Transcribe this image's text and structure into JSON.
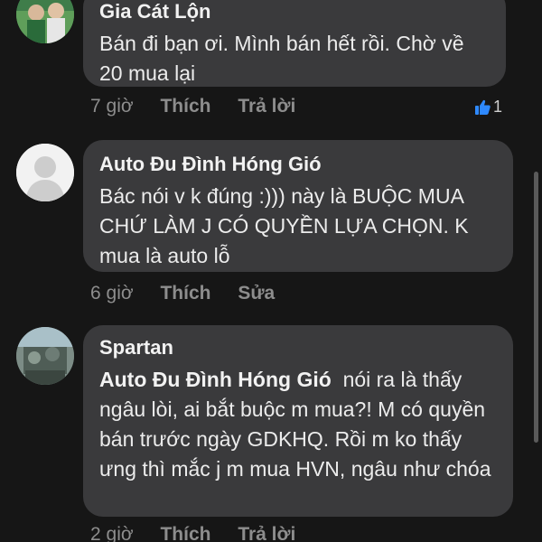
{
  "comments": [
    {
      "author": "Gia Cát Lộn",
      "text": "Bán đi bạn ơi. Mình bán hết rồi. Chờ về 20 mua lại",
      "time": "7 giờ",
      "like_label": "Thích",
      "second_action": "Trả lời",
      "reaction_count": "1",
      "reaction_icon": "thumbs-up-icon",
      "reaction_color": "#2e89ff"
    },
    {
      "author": "Auto Đu Đình Hóng Gió",
      "text": "Bác nói v k đúng :))) này là BUỘC MUA CHỨ LÀM J CÓ QUYỀN LỰA CHỌN. K mua là auto lỗ",
      "time": "6 giờ",
      "like_label": "Thích",
      "second_action": "Sửa"
    },
    {
      "author": "Spartan",
      "mention": "Auto Đu Đình Hóng Gió",
      "text": "nói ra là thấy ngâu lòi, ai bắt buộc m mua?! M có quyền bán trước ngày GDKHQ. Rồi m ko thấy ưng thì mắc j m mua HVN, ngâu như chóa",
      "time": "2 giờ",
      "like_label": "Thích",
      "second_action": "Trả lời"
    }
  ],
  "colors": {
    "background": "#161616",
    "bubble": "#3a3a3c",
    "muted_text": "#8d8d8d"
  }
}
